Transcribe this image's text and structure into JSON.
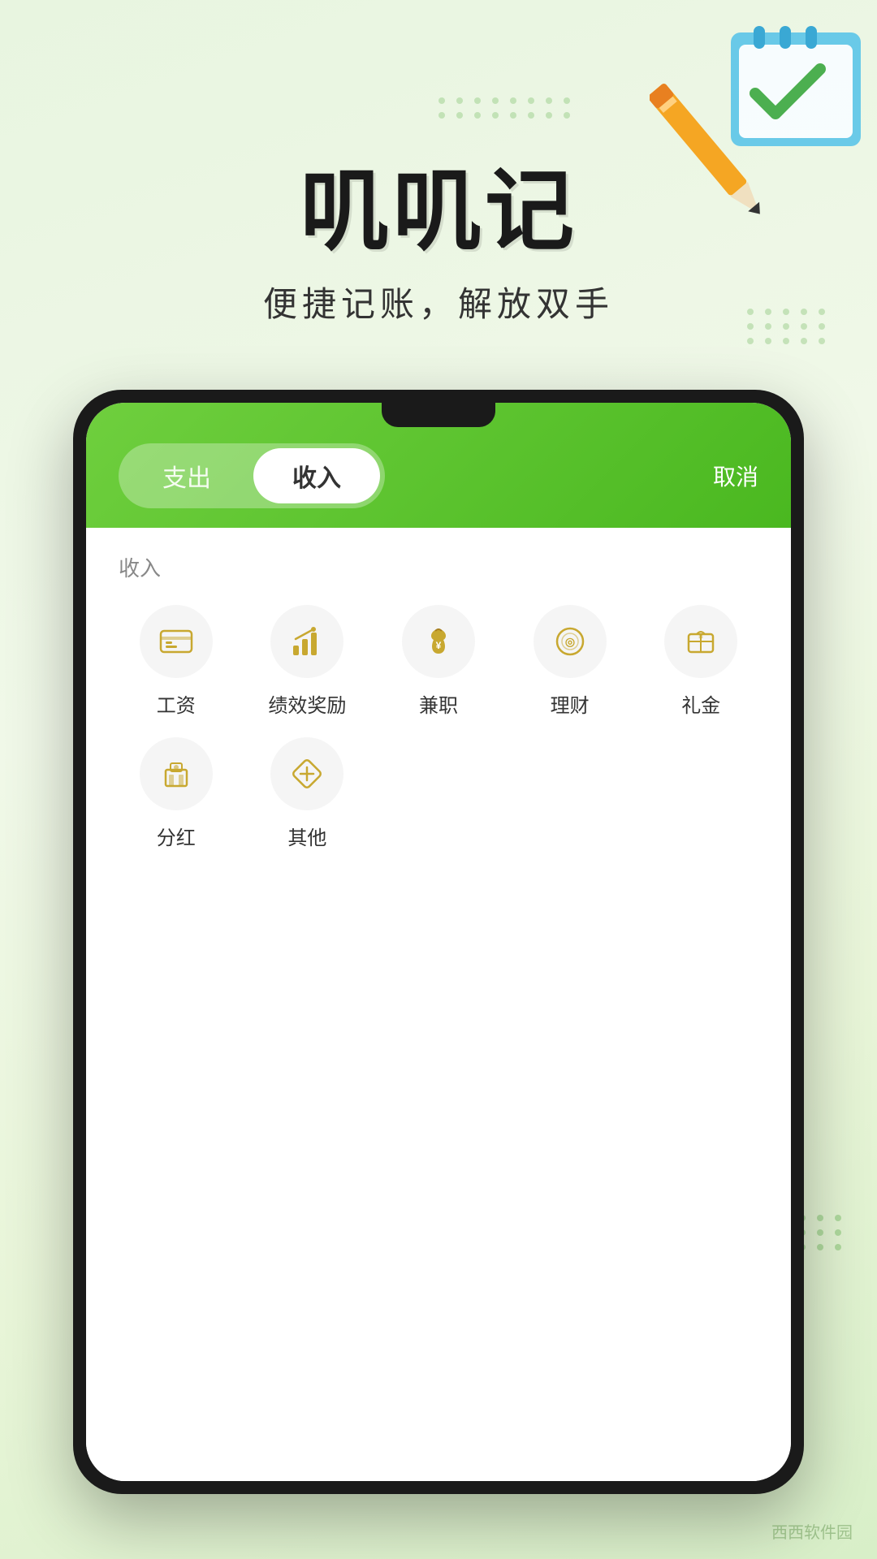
{
  "app": {
    "title": "叽叽记",
    "subtitle": "便捷记账，解放双手"
  },
  "header": {
    "tab_expense": "支出",
    "tab_income": "收入",
    "cancel_label": "取消",
    "active_tab": "收入"
  },
  "income_section": {
    "label": "收入",
    "categories": [
      {
        "id": "salary",
        "name": "工资",
        "icon": "salary"
      },
      {
        "id": "performance",
        "name": "绩效奖励",
        "icon": "performance"
      },
      {
        "id": "parttime",
        "name": "兼职",
        "icon": "parttime"
      },
      {
        "id": "investment",
        "name": "理财",
        "icon": "investment"
      },
      {
        "id": "gift",
        "name": "礼金",
        "icon": "gift"
      },
      {
        "id": "dividend",
        "name": "分红",
        "icon": "dividend"
      },
      {
        "id": "other",
        "name": "其他",
        "icon": "other"
      }
    ]
  },
  "decoration": {
    "pencil_color": "#F5A623",
    "notebook_color": "#5BC4E8"
  }
}
